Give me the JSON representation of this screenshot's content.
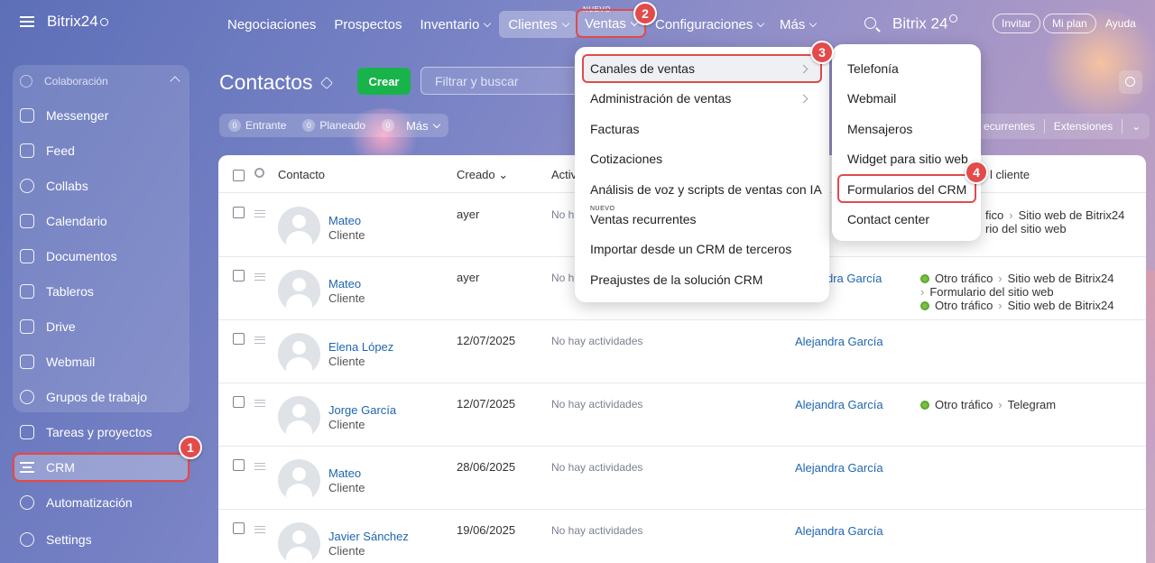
{
  "sidebar": {
    "brand": "Bitrix24",
    "group_label": "Colaboración",
    "items": [
      {
        "label": "Messenger",
        "icon": "chat-icon"
      },
      {
        "label": "Feed",
        "icon": "feed-icon"
      },
      {
        "label": "Collabs",
        "icon": "collabs-icon"
      },
      {
        "label": "Calendario",
        "icon": "calendar-icon"
      },
      {
        "label": "Documentos",
        "icon": "document-icon"
      },
      {
        "label": "Tableros",
        "icon": "board-icon"
      },
      {
        "label": "Drive",
        "icon": "drive-icon"
      },
      {
        "label": "Webmail",
        "icon": "mail-icon"
      },
      {
        "label": "Grupos de trabajo",
        "icon": "group-icon"
      }
    ],
    "tareas": "Tareas y proyectos",
    "crm": "CRM",
    "automatizacion": "Automatización",
    "settings": "Settings"
  },
  "topnav": {
    "items": [
      "Negociaciones",
      "Prospectos",
      "Inventario",
      "Clientes"
    ],
    "nuevo": "NUEVO",
    "ventas": "Ventas",
    "configuraciones": "Configuraciones",
    "mas": "Más",
    "brand": "Bitrix 24",
    "invitar": "Invitar",
    "mi_plan": "Mi plan",
    "ayuda": "Ayuda"
  },
  "page": {
    "title": "Contactos",
    "create": "Crear",
    "filter_placeholder": "Filtrar y buscar",
    "counters": [
      {
        "num": "0",
        "label": "Entrante"
      },
      {
        "num": "0",
        "label": "Planeado"
      },
      {
        "num": "0",
        "label": ""
      }
    ],
    "mas": "Más",
    "right_tabs": [
      "ecurrentes",
      "Extensiones"
    ]
  },
  "table": {
    "headers": {
      "contact": "Contacto",
      "created": "Creado",
      "activity": "Activ",
      "source_tail": "l cliente"
    },
    "rows": [
      {
        "name": "Mateo",
        "type": "Cliente",
        "date": "ayer",
        "activity": "No h",
        "resp": "",
        "sources": [
          "fico",
          "Sitio web de Bitrix24",
          "rio del sitio web"
        ]
      },
      {
        "name": "Mateo",
        "type": "Cliente",
        "date": "ayer",
        "activity": "No h",
        "resp": "dra García",
        "sources": [
          "Otro tráfico",
          "Sitio web de Bitrix24",
          "Formulario del sitio web",
          "Otro tráfico",
          "Sitio web de Bitrix24"
        ]
      },
      {
        "name": "Elena López",
        "type": "Cliente",
        "date": "12/07/2025",
        "activity": "No hay actividades",
        "resp": "Alejandra García",
        "sources": []
      },
      {
        "name": "Jorge García",
        "type": "Cliente",
        "date": "12/07/2025",
        "activity": "No hay actividades",
        "resp": "Alejandra García",
        "sources": [
          "Otro tráfico",
          "Telegram"
        ]
      },
      {
        "name": "Mateo",
        "type": "Cliente",
        "date": "28/06/2025",
        "activity": "No hay actividades",
        "resp": "Alejandra García",
        "sources": []
      },
      {
        "name": "Javier Sánchez",
        "type": "Cliente",
        "date": "19/06/2025",
        "activity": "No hay actividades",
        "resp": "Alejandra García",
        "sources": []
      }
    ]
  },
  "ventas_menu": {
    "items": [
      "Canales de ventas",
      "Administración de ventas",
      "Facturas",
      "Cotizaciones",
      "Análisis de voz y scripts de ventas con IA",
      "Ventas recurrentes",
      "Importar desde un CRM de terceros",
      "Preajustes de la solución CRM"
    ],
    "nuevo": "NUEVO"
  },
  "canales_menu": {
    "items": [
      "Telefonía",
      "Webmail",
      "Mensajeros",
      "Widget para sitio web",
      "Formularios del CRM",
      "Contact center"
    ]
  },
  "badges": [
    "1",
    "2",
    "3",
    "4"
  ],
  "colors": {
    "accent": "#e04b4b",
    "create": "#19b34b",
    "link": "#2066b0"
  }
}
